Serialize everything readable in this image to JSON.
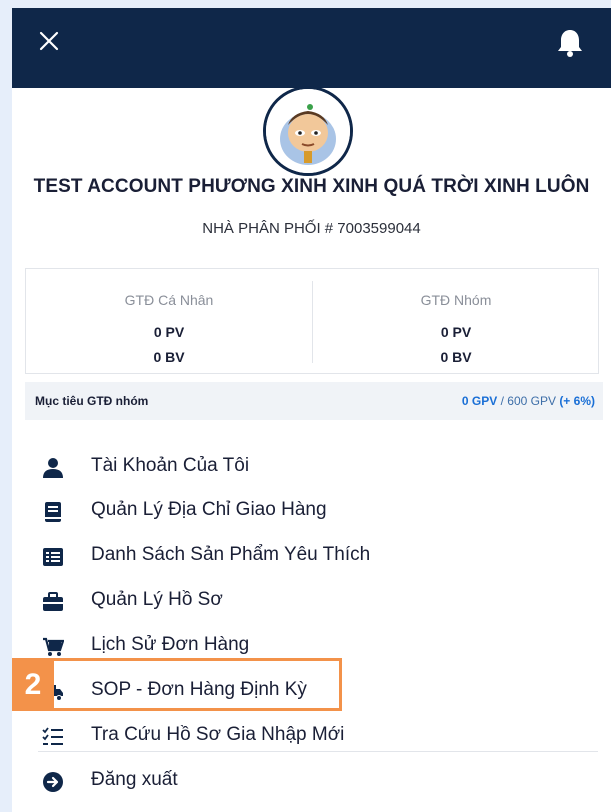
{
  "header": {
    "close_icon": "close-icon",
    "bell_icon": "bell-icon",
    "background": "#0f2749"
  },
  "profile": {
    "account_name": "TEST ACCOUNT PHƯƠNG XINH XINH QUÁ TRỜI XINH LUÔN",
    "distributor": "NHÀ PHÂN PHỐI # 7003599044"
  },
  "stats": {
    "personal": {
      "label": "GTĐ Cá Nhân",
      "pv": "0 PV",
      "bv": "0 BV"
    },
    "group": {
      "label": "GTĐ Nhóm",
      "pv": "0 PV",
      "bv": "0 BV"
    }
  },
  "goal": {
    "label": "Mục tiêu GTĐ nhóm",
    "current": "0 GPV",
    "target": " / 600 GPV ",
    "percent": "(+ 6%)"
  },
  "menu": {
    "items": [
      {
        "label": "Tài Khoản Của Tôi",
        "icon": "user-icon"
      },
      {
        "label": "Quản Lý Địa Chỉ Giao Hàng",
        "icon": "address-book-icon"
      },
      {
        "label": "Danh Sách Sản Phẩm Yêu Thích",
        "icon": "list-icon"
      },
      {
        "label": "Quản Lý Hồ Sơ",
        "icon": "briefcase-icon"
      },
      {
        "label": "Lịch Sử Đơn Hàng",
        "icon": "cart-icon"
      },
      {
        "label": "SOP - Đơn Hàng Định Kỳ",
        "icon": "truck-icon"
      },
      {
        "label": "Tra Cứu Hồ Sơ Gia Nhập Mới",
        "icon": "checklist-icon"
      },
      {
        "label": "Đăng xuất",
        "icon": "logout-icon"
      }
    ]
  },
  "annotation": {
    "step": "2",
    "color": "#f3924a"
  }
}
